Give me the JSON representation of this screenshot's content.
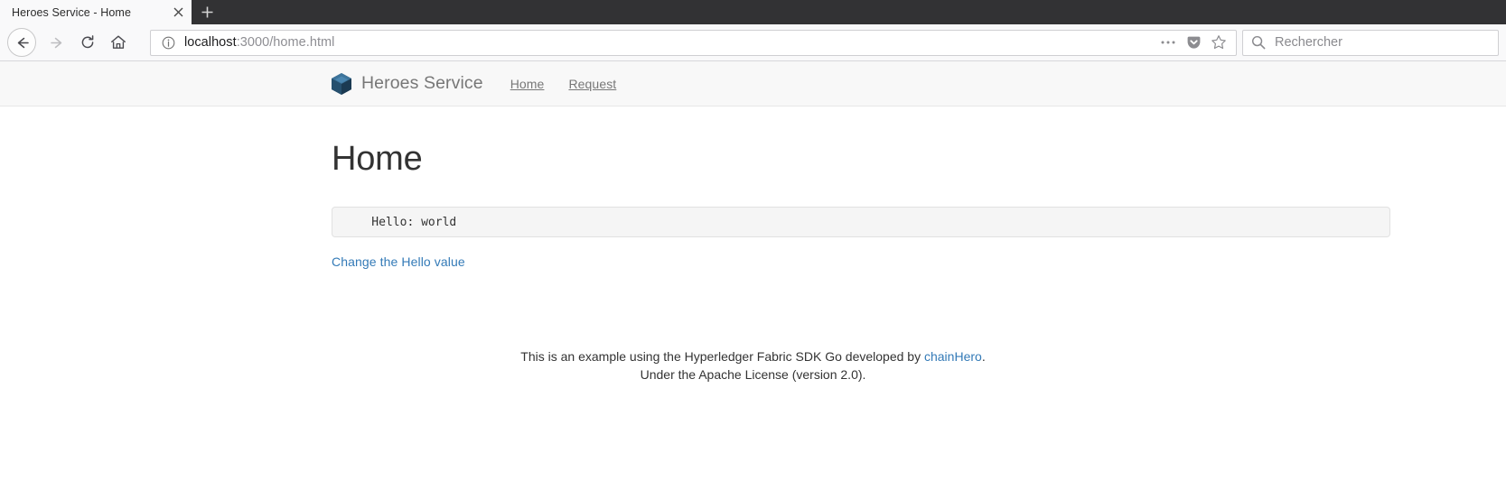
{
  "browser": {
    "tab": {
      "title": "Heroes Service - Home",
      "close_icon": "close-icon"
    },
    "new_tab_label": "+",
    "toolbar": {
      "back_icon": "back-arrow-icon",
      "forward_icon": "forward-arrow-icon",
      "reload_icon": "reload-icon",
      "home_icon": "home-icon",
      "identity_icon": "info-circle-icon",
      "url_host": "localhost",
      "url_path": ":3000/home.html",
      "page_actions_icon": "ellipsis-icon",
      "pocket_icon": "pocket-icon",
      "bookmark_icon": "star-icon"
    },
    "search": {
      "icon": "search-icon",
      "placeholder": "Rechercher",
      "value": ""
    }
  },
  "page": {
    "navbar": {
      "logo_icon": "hyperledger-cube-icon",
      "brand": "Heroes Service",
      "links": [
        {
          "label": "Home"
        },
        {
          "label": "Request"
        }
      ]
    },
    "main": {
      "title": "Home",
      "code_output": "    Hello: world",
      "change_link": "Change the Hello value"
    },
    "footer": {
      "line1_pre": "This is an example using the Hyperledger Fabric SDK Go developed by ",
      "line1_link": "chainHero",
      "line1_post": ".",
      "line2": "Under the Apache License (version 2.0)."
    }
  },
  "colors": {
    "accent_link": "#337ab7",
    "brand_logo": "#1b4f72",
    "chrome_dark": "#323234",
    "chrome_light": "#f9f9fa"
  }
}
